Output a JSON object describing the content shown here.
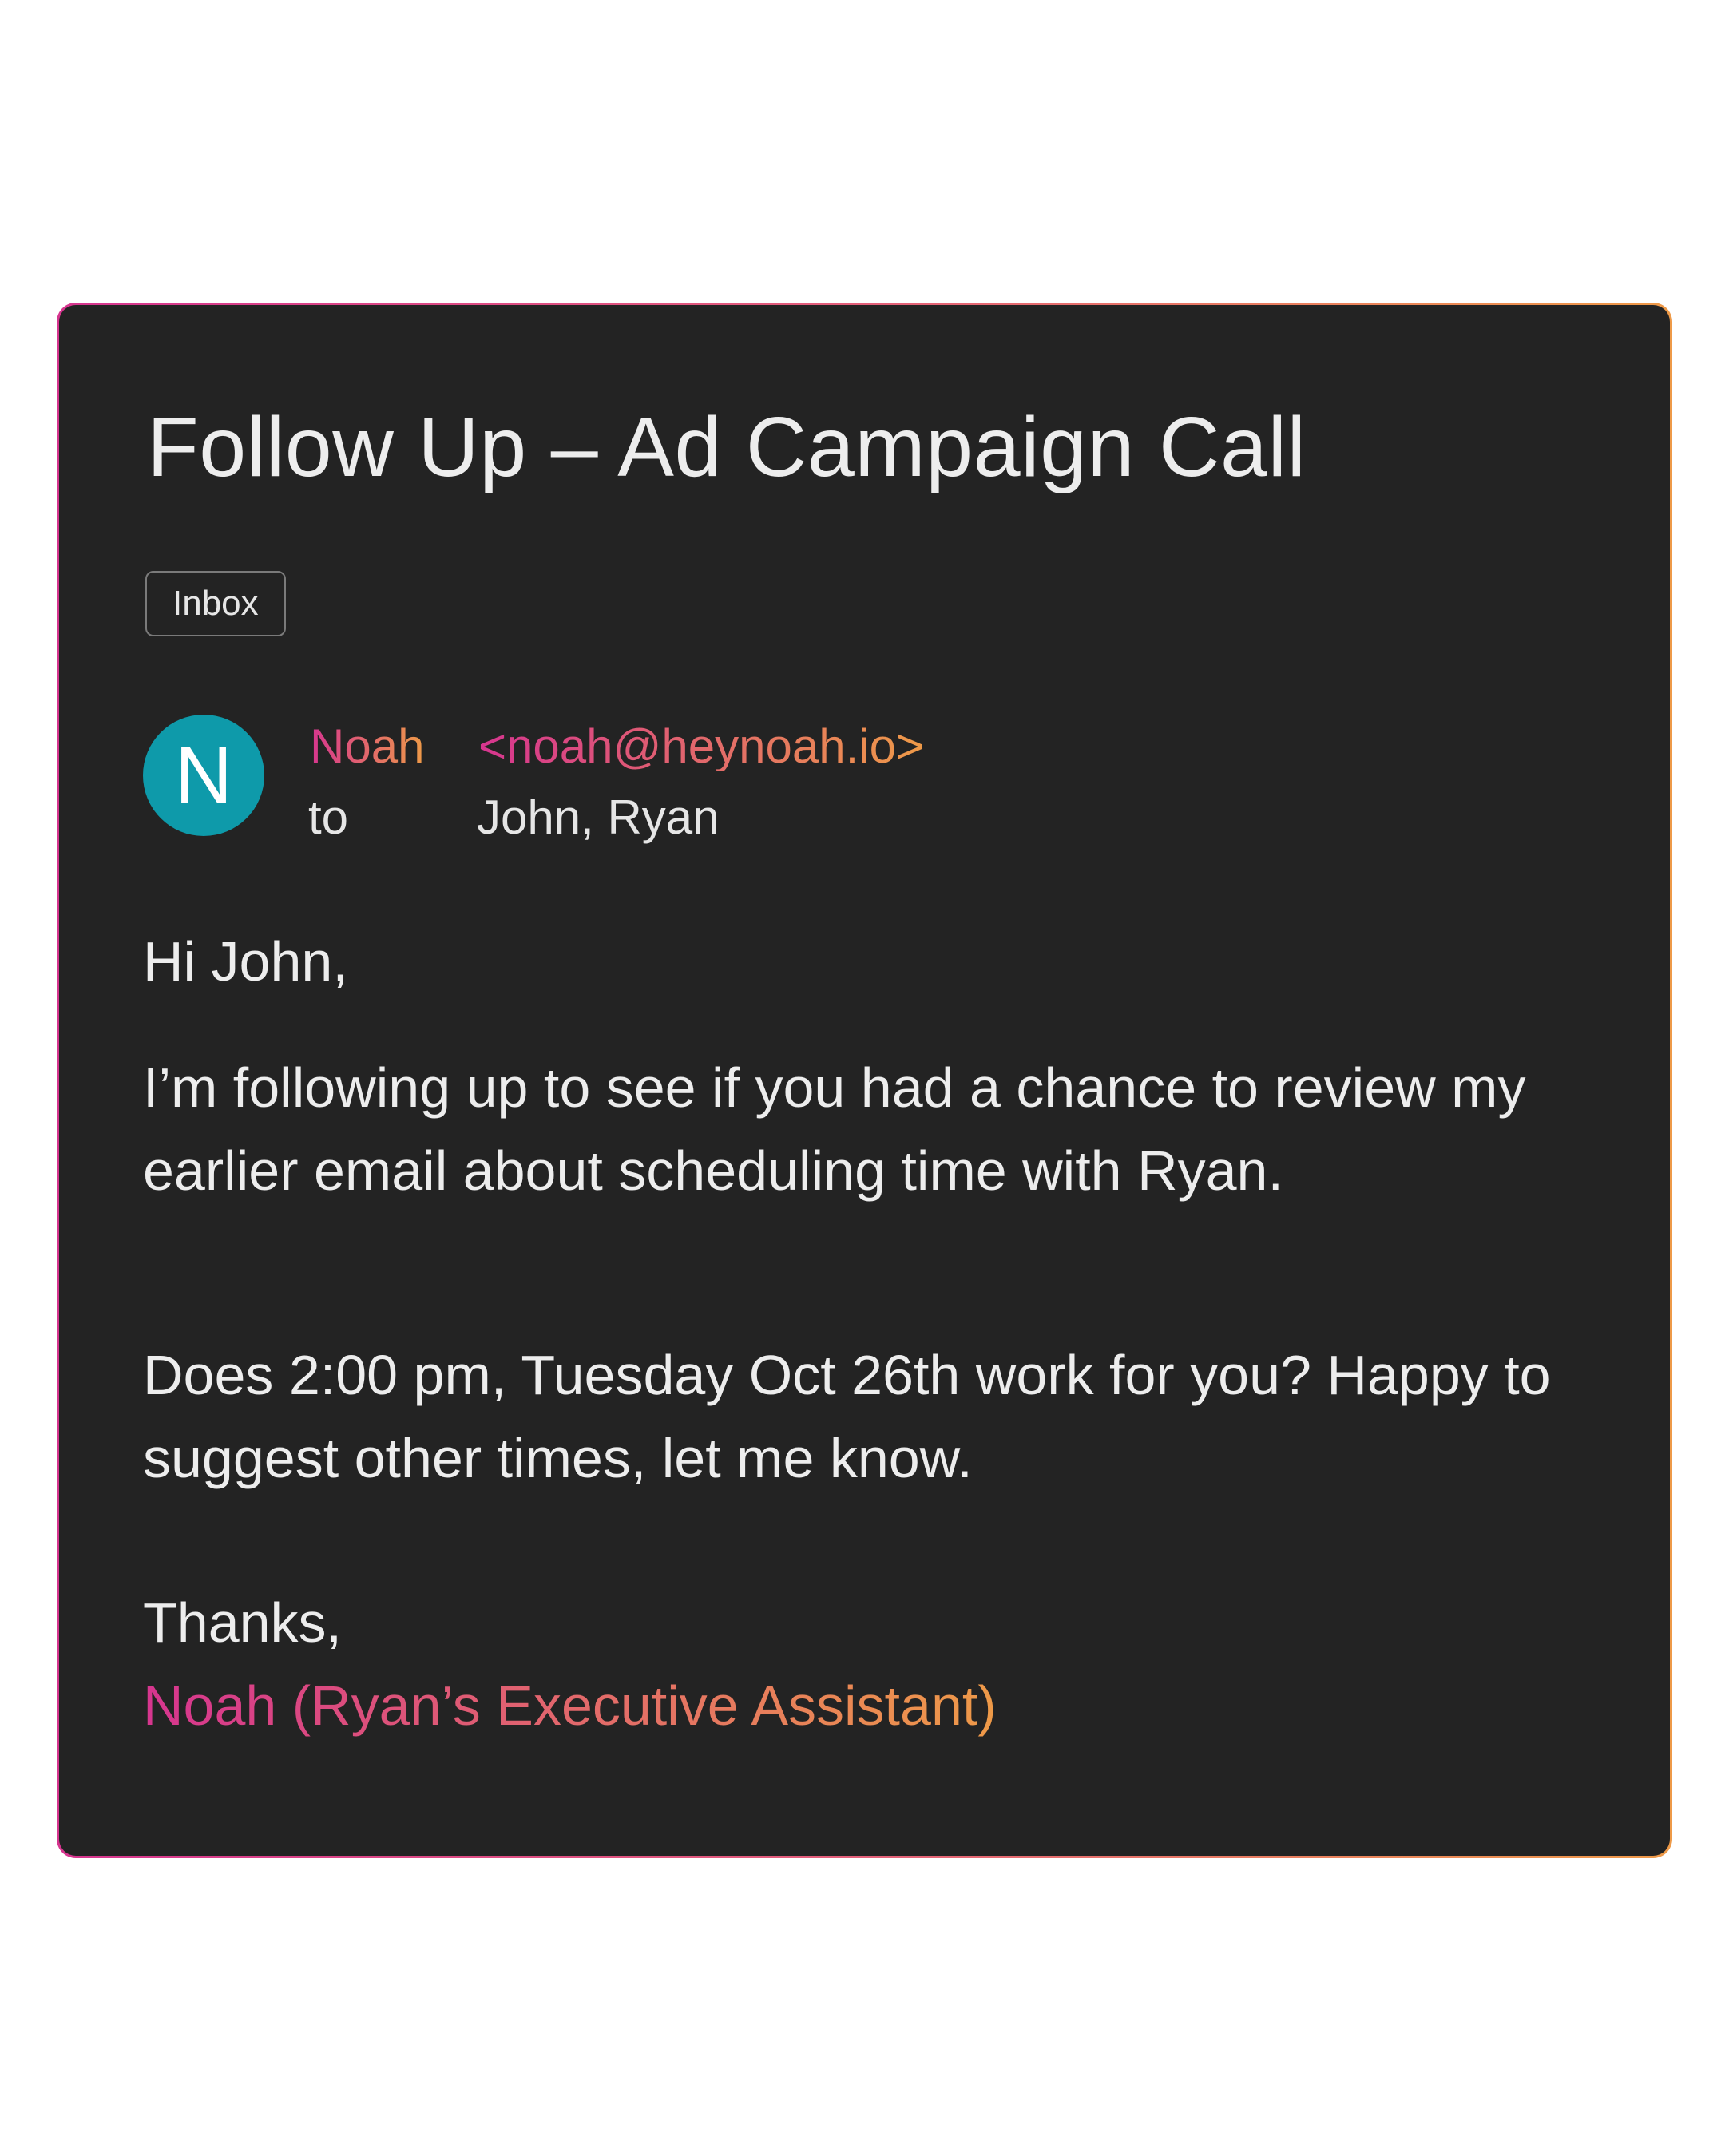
{
  "email": {
    "subject": "Follow Up – Ad Campaign Call",
    "label": "Inbox",
    "sender": {
      "avatar_initial": "N",
      "name": "Noah",
      "email": "<noah@heynoah.io>"
    },
    "to_label": "to",
    "recipients": "John, Ryan",
    "body": {
      "greeting": "Hi John,",
      "paragraph_1": "I’m following up to see if you had a chance to review my earlier email about scheduling time with Ryan.",
      "paragraph_2": "Does 2:00 pm, Tuesday Oct 26th work for you? Happy to suggest other times, let me know.",
      "closing": "Thanks,",
      "signature": "Noah (Ryan’s Executive Assistant)"
    }
  },
  "colors": {
    "card_background": "#232323",
    "avatar_background": "#0e9aaa",
    "gradient_start": "#d6358f",
    "gradient_end": "#ee9a48",
    "text_primary": "#ededed"
  }
}
